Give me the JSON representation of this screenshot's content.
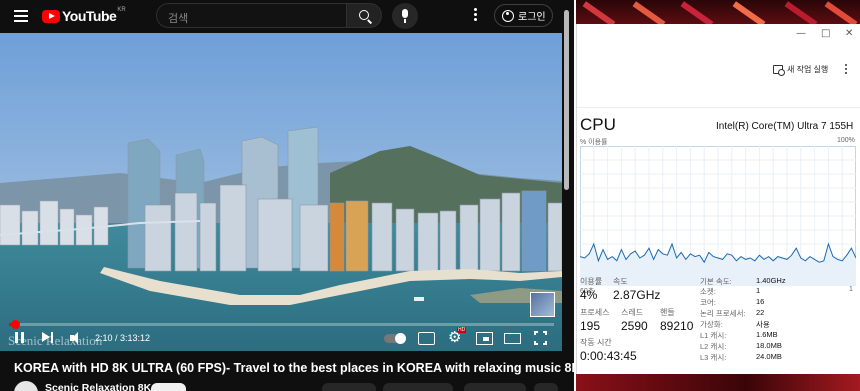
{
  "youtube": {
    "logo_text": "YouTube",
    "logo_region": "KR",
    "search_placeholder": "검색",
    "login_label": "로그인",
    "watermark": "Scenic Relaxation",
    "time_display": "2:10 / 3:13:12",
    "progress_fraction": 0.011,
    "video_title": "KOREA with HD 8K ULTRA (60 FPS)- Travel to the best places in KOREA with relaxing music 8K TV",
    "channel_name": "Scenic Relaxation 8K"
  },
  "task_manager": {
    "run_new_task": "새 작업 실행",
    "title": "CPU",
    "model": "Intel(R) Core(TM) Ultra 7 155H",
    "graph_label_left": "% 이용률",
    "graph_label_right": "100%",
    "graph_bottom_left": "60초",
    "graph_bottom_right": "1",
    "utilization_series": [
      21,
      20,
      23,
      30,
      18,
      26,
      19,
      21,
      18,
      26,
      19,
      23,
      25,
      20,
      22,
      27,
      19,
      26,
      23,
      22,
      30,
      20,
      24,
      19,
      23,
      21,
      22,
      17,
      24,
      21,
      20,
      19,
      23,
      22,
      18,
      21,
      19,
      20,
      18,
      22,
      19,
      21,
      18,
      21,
      20,
      19,
      22,
      27,
      20,
      18,
      21,
      19,
      17,
      18,
      30,
      21,
      19,
      18,
      22,
      27,
      20
    ],
    "stats": {
      "utilization": {
        "label": "이용률",
        "value": "4%"
      },
      "speed": {
        "label": "속도",
        "value": "2.87GHz"
      },
      "processes": {
        "label": "프로세스",
        "value": "195"
      },
      "threads": {
        "label": "스레드",
        "value": "2590"
      },
      "handles": {
        "label": "핸들",
        "value": "89210"
      },
      "uptime": {
        "label": "작동 시간",
        "value": "0:00:43:45"
      }
    },
    "specs": [
      {
        "label": "기본 속도:",
        "value": "1.40GHz"
      },
      {
        "label": "소켓:",
        "value": "1"
      },
      {
        "label": "코어:",
        "value": "16"
      },
      {
        "label": "논리 프로세서:",
        "value": "22"
      },
      {
        "label": "가상화:",
        "value": "사용"
      },
      {
        "label": "L1 캐시:",
        "value": "1.6MB"
      },
      {
        "label": "L2 캐시:",
        "value": "18.0MB"
      },
      {
        "label": "L3 캐시:",
        "value": "24.0MB"
      }
    ]
  },
  "colors": {
    "youtube_red": "#ff0000",
    "graph_line": "#1c6ab3",
    "graph_fill": "#e8f0fa"
  },
  "icons": [
    "menu-icon",
    "youtube-logo-icon",
    "search-icon",
    "microphone-icon",
    "more-vert-icon",
    "account-icon",
    "pause-icon",
    "next-icon",
    "volume-icon",
    "autoplay-toggle-icon",
    "captions-icon",
    "settings-icon",
    "miniplayer-icon",
    "theater-icon",
    "fullscreen-icon",
    "run-task-icon",
    "more-options-icon"
  ]
}
